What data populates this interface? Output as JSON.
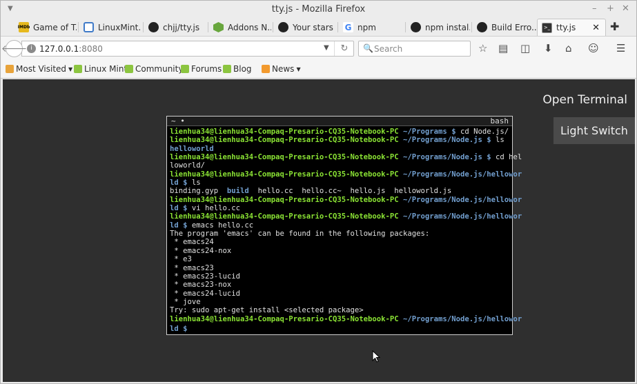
{
  "window": {
    "title": "tty.js - Mozilla Firefox"
  },
  "tabs": [
    {
      "label": "Game of T...",
      "icon": "imdb-icon"
    },
    {
      "label": "LinuxMint...",
      "icon": "linuxmint-icon"
    },
    {
      "label": "chjj/tty.js",
      "icon": "github-icon"
    },
    {
      "label": "Addons N...",
      "icon": "nodejs-icon"
    },
    {
      "label": "Your stars",
      "icon": "github-icon"
    },
    {
      "label": "npm",
      "icon": "google-icon"
    },
    {
      "label": "npm instal...",
      "icon": "github-icon"
    },
    {
      "label": "Build Erro...",
      "icon": "github-icon"
    },
    {
      "label": "tty.js",
      "icon": "terminal-icon",
      "active": true
    }
  ],
  "navbar": {
    "url_host": "127.0.0.1",
    "url_port": ":8080",
    "search_placeholder": "Search"
  },
  "bookmarks": [
    {
      "label": "Most Visited",
      "dropdown": true
    },
    {
      "label": "Linux Mint"
    },
    {
      "label": "Community"
    },
    {
      "label": "Forums"
    },
    {
      "label": "Blog"
    },
    {
      "label": "News",
      "dropdown": true
    }
  ],
  "page": {
    "open_terminal_label": "Open Terminal",
    "light_switch_label": "Light Switch"
  },
  "terminal": {
    "tab_label": "~ •",
    "shell_label": "bash",
    "user_host": "lienhua34@lienhua34-Compaq-Presario-CQ35-Notebook-PC",
    "lines": [
      {
        "prompt": true,
        "path": " ~/Programs $",
        "cmd": " cd Node.js/"
      },
      {
        "prompt": true,
        "path": " ~/Programs/Node.js $",
        "cmd": " ls"
      },
      {
        "dir": "helloworld"
      },
      {
        "prompt": true,
        "path": " ~/Programs/Node.js $",
        "cmd": " cd hel"
      },
      {
        "text": "loworld/"
      },
      {
        "prompt": true,
        "path": " ~/Programs/Node.js/hellowor"
      },
      {
        "path_only": "ld $",
        "cmd": " ls"
      },
      {
        "ls": [
          "binding.gyp  ",
          "build",
          "  hello.cc  hello.cc~  hello.js  helloworld.js"
        ]
      },
      {
        "prompt": true,
        "path": " ~/Programs/Node.js/hellowor"
      },
      {
        "path_only": "ld $",
        "cmd": " vi hello.cc"
      },
      {
        "prompt": true,
        "path": " ~/Programs/Node.js/hellowor"
      },
      {
        "path_only": "ld $",
        "cmd": " emacs hello.cc"
      },
      {
        "text": "The program 'emacs' can be found in the following packages:"
      },
      {
        "text": " * emacs24"
      },
      {
        "text": " * emacs24-nox"
      },
      {
        "text": " * e3"
      },
      {
        "text": " * emacs23"
      },
      {
        "text": " * emacs23-lucid"
      },
      {
        "text": " * emacs23-nox"
      },
      {
        "text": " * emacs24-lucid"
      },
      {
        "text": " * jove"
      },
      {
        "text": "Try: sudo apt-get install <selected package>"
      },
      {
        "prompt": true,
        "path": " ~/Programs/Node.js/hellowor"
      },
      {
        "path_only": "ld $",
        "cmd": " ",
        "cursor": true
      }
    ]
  },
  "colors": {
    "page_bg": "#2f2f2f",
    "prompt_user": "#8ae234",
    "prompt_path": "#729fcf"
  }
}
